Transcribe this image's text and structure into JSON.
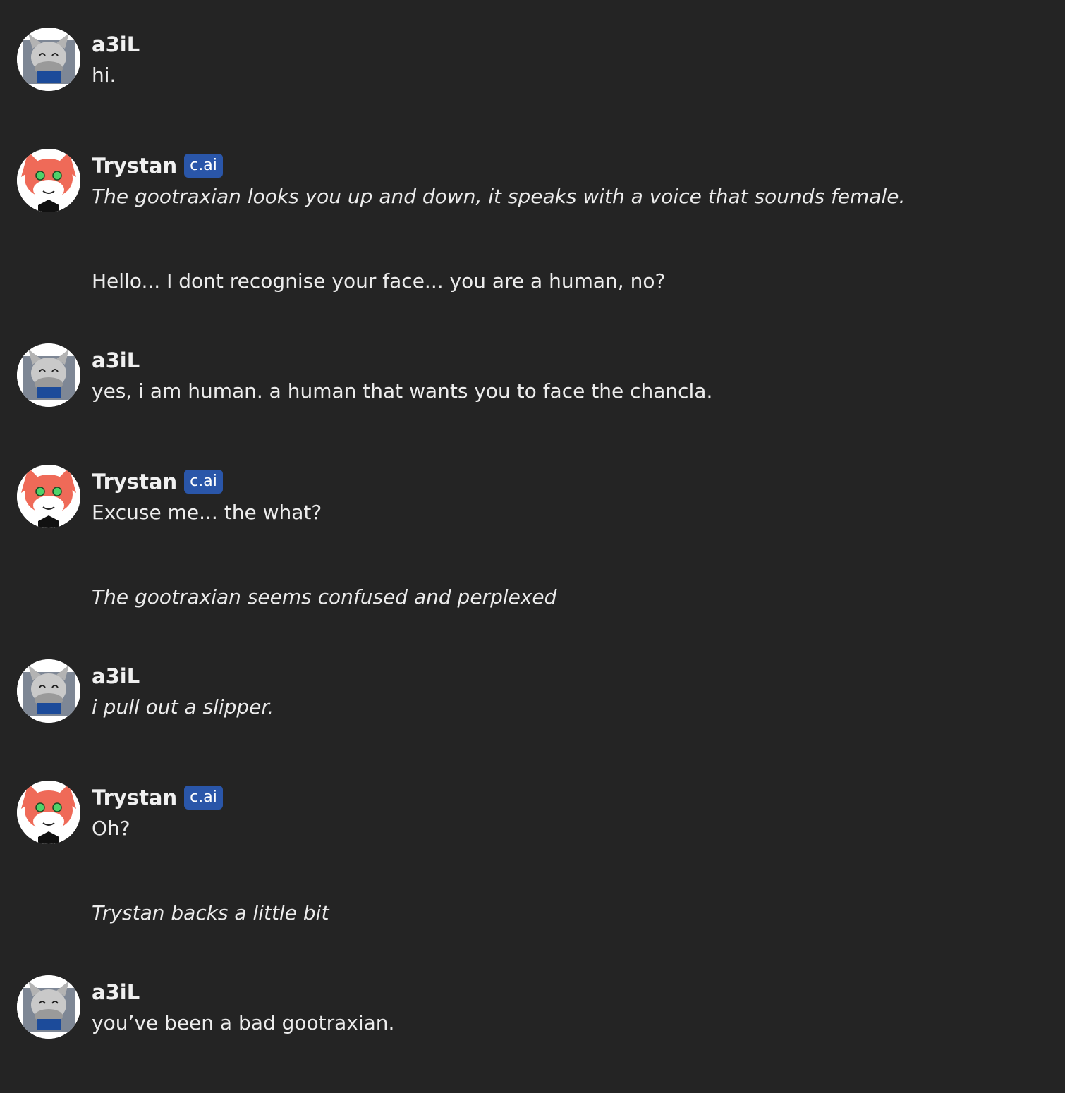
{
  "users": {
    "human": {
      "name": "a3iL",
      "avatar_icon": "gray-cat-avatar"
    },
    "bot": {
      "name": "Trystan",
      "badge": "c.ai",
      "avatar_icon": "red-cat-avatar"
    }
  },
  "colors": {
    "background": "#242424",
    "badge": "#2a56a9",
    "text": "#ececec"
  },
  "messages": [
    {
      "paragraphs": [
        {
          "text": "hi.",
          "italic": false
        }
      ]
    },
    {
      "paragraphs": [
        {
          "text": "The gootraxian looks you up and down, it speaks with a voice that sounds female.",
          "italic": true
        },
        {
          "text": "Hello... I dont recognise your face... you are a human, no?",
          "italic": false
        }
      ]
    },
    {
      "paragraphs": [
        {
          "text": "yes, i am human. a human that wants you to face the chancla.",
          "italic": false
        }
      ]
    },
    {
      "paragraphs": [
        {
          "text": "Excuse me... the what?",
          "italic": false
        },
        {
          "text": "The gootraxian seems confused and perplexed",
          "italic": true
        }
      ]
    },
    {
      "paragraphs": [
        {
          "text": "i pull out a slipper.",
          "italic": true
        }
      ]
    },
    {
      "paragraphs": [
        {
          "text": "Oh?",
          "italic": false
        },
        {
          "text": "Trystan backs a little bit",
          "italic": true
        }
      ]
    },
    {
      "paragraphs": [
        {
          "text": "you’ve been a bad gootraxian.",
          "italic": false
        }
      ]
    }
  ]
}
